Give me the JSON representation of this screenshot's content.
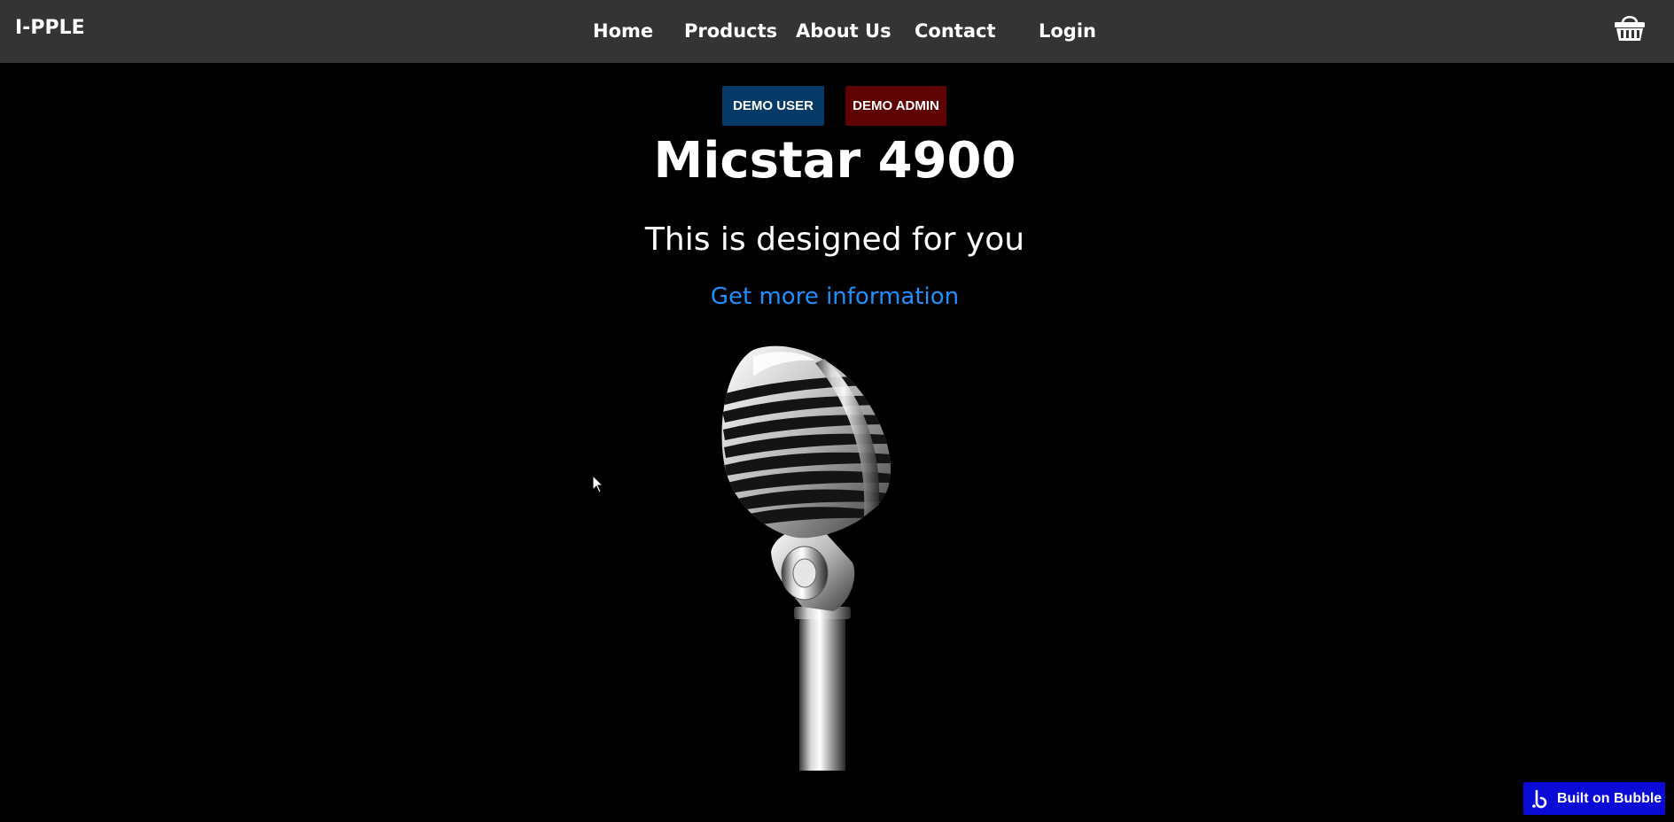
{
  "header": {
    "brand": "I-PPLE",
    "nav": {
      "home": "Home",
      "products": "Products",
      "about": "About Us",
      "contact": "Contact",
      "login": "Login"
    },
    "cart_icon": "basket-icon"
  },
  "demo": {
    "user_label": "DEMO USER",
    "admin_label": "DEMO ADMIN"
  },
  "hero": {
    "title": "Micstar 4900",
    "subtitle": "This is designed for you",
    "link": "Get more information",
    "image_icon": "microphone-image"
  },
  "badge": {
    "label": "Built on Bubble",
    "icon": "bubble-logo-icon"
  },
  "colors": {
    "header_bg": "#343434",
    "page_bg": "#000000",
    "demo_user_bg": "#063a66",
    "demo_admin_bg": "#5f0204",
    "link": "#1e90ff",
    "badge_bg": "#0b0bd8"
  }
}
